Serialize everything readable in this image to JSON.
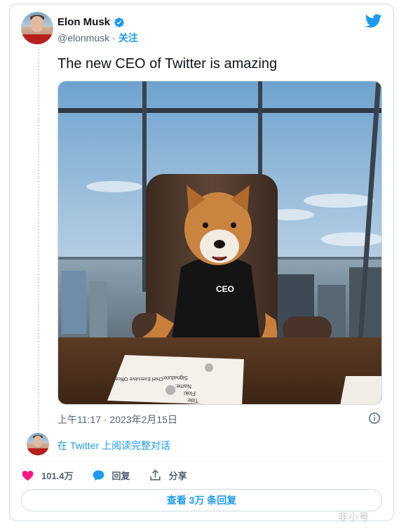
{
  "author": {
    "display_name": "Elon Musk",
    "handle": "@elonmusk",
    "separator": "·",
    "follow_label": "关注",
    "verified": true
  },
  "tweet": {
    "text": "The new CEO of Twitter is amazing",
    "photo": {
      "sweater_text": "CEO",
      "paper_lines": [
        "Signature:",
        "Name:",
        "Floki",
        "Title:",
        "Chief Executive Officer"
      ]
    },
    "timestamp": "上午11:17 · 2023年2月15日"
  },
  "thread": {
    "read_conversation_label": "在 Twitter 上阅读完整对话"
  },
  "actions": {
    "like_count": "101.4万",
    "reply_label": "回复",
    "share_label": "分享"
  },
  "more_replies_label": "查看 3万 条回复",
  "watermark": "非小号",
  "colors": {
    "accent": "#1d9bf0",
    "like": "#f91880",
    "text": "#0f1419",
    "secondary": "#536471",
    "border": "#cfd9de"
  },
  "icons": [
    "verified-badge-icon",
    "twitter-bird-icon",
    "info-icon",
    "heart-icon",
    "reply-bubble-icon",
    "share-icon"
  ]
}
